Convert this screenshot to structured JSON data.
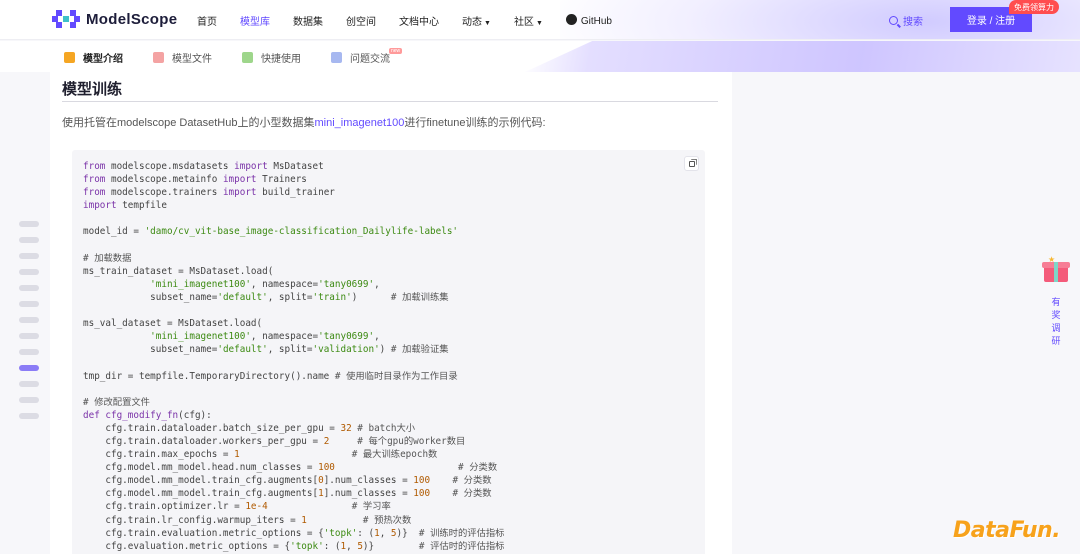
{
  "brand": {
    "name": "ModelScope",
    "accent": "#624aff"
  },
  "nav": {
    "items": [
      {
        "label": "首页",
        "active": false
      },
      {
        "label": "模型库",
        "active": true
      },
      {
        "label": "数据集",
        "active": false
      },
      {
        "label": "创空间",
        "active": false
      },
      {
        "label": "文档中心",
        "active": false
      },
      {
        "label": "动态",
        "active": false,
        "dropdown": true
      },
      {
        "label": "社区",
        "active": false,
        "dropdown": true
      },
      {
        "label": "GitHub",
        "active": false,
        "icon": "github-icon"
      }
    ],
    "search_label": "搜索",
    "login_label": "登录 / 注册",
    "badge": "免费领算力"
  },
  "subtabs": [
    {
      "label": "模型介绍",
      "active": true,
      "icon": "cube-icon",
      "color": "#f5a623"
    },
    {
      "label": "模型文件",
      "active": false,
      "icon": "file-icon",
      "color": "#f4a3a3"
    },
    {
      "label": "快捷使用",
      "active": false,
      "icon": "send-icon",
      "color": "#9ed68b"
    },
    {
      "label": "问题交流",
      "active": false,
      "icon": "chat-icon",
      "color": "#a7b8f0",
      "badge": "new"
    }
  ],
  "section": {
    "title": "模型训练",
    "intro_before": "使用托管在modelscope DatasetHub上的小型数据集",
    "intro_link": "mini_imagenet100",
    "intro_after": "进行finetune训练的示例代码:"
  },
  "code_lines": [
    [
      [
        "kw",
        "from"
      ],
      [
        "t",
        " modelscope.msdatasets "
      ],
      [
        "kw",
        "import"
      ],
      [
        "t",
        " MsDataset"
      ]
    ],
    [
      [
        "kw",
        "from"
      ],
      [
        "t",
        " modelscope.metainfo "
      ],
      [
        "kw",
        "import"
      ],
      [
        "t",
        " Trainers"
      ]
    ],
    [
      [
        "kw",
        "from"
      ],
      [
        "t",
        " modelscope.trainers "
      ],
      [
        "kw",
        "import"
      ],
      [
        "t",
        " build_trainer"
      ]
    ],
    [
      [
        "kw",
        "import"
      ],
      [
        "t",
        " tempfile"
      ]
    ],
    [],
    [
      [
        "t",
        "model_id = "
      ],
      [
        "str",
        "'damo/cv_vit-base_image-classification_Dailylife-labels'"
      ]
    ],
    [],
    [
      [
        "cm",
        "# 加载数据"
      ]
    ],
    [
      [
        "t",
        "ms_train_dataset = MsDataset.load("
      ]
    ],
    [
      [
        "t",
        "            "
      ],
      [
        "str",
        "'mini_imagenet100'"
      ],
      [
        "t",
        ", namespace="
      ],
      [
        "str",
        "'tany0699'"
      ],
      [
        "t",
        ","
      ]
    ],
    [
      [
        "t",
        "            subset_name="
      ],
      [
        "str",
        "'default'"
      ],
      [
        "t",
        ", split="
      ],
      [
        "str",
        "'train'"
      ],
      [
        "t",
        ")      "
      ],
      [
        "cm",
        "# 加载训练集"
      ]
    ],
    [],
    [
      [
        "t",
        "ms_val_dataset = MsDataset.load("
      ]
    ],
    [
      [
        "t",
        "            "
      ],
      [
        "str",
        "'mini_imagenet100'"
      ],
      [
        "t",
        ", namespace="
      ],
      [
        "str",
        "'tany0699'"
      ],
      [
        "t",
        ","
      ]
    ],
    [
      [
        "t",
        "            subset_name="
      ],
      [
        "str",
        "'default'"
      ],
      [
        "t",
        ", split="
      ],
      [
        "str",
        "'validation'"
      ],
      [
        "t",
        ") "
      ],
      [
        "cm",
        "# 加载验证集"
      ]
    ],
    [],
    [
      [
        "t",
        "tmp_dir = tempfile.TemporaryDirectory().name "
      ],
      [
        "cm",
        "# 使用临时目录作为工作目录"
      ]
    ],
    [],
    [
      [
        "cm",
        "# 修改配置文件"
      ]
    ],
    [
      [
        "kw",
        "def"
      ],
      [
        "kw",
        " cfg_modify_fn"
      ],
      [
        "t",
        "(cfg):"
      ]
    ],
    [
      [
        "t",
        "    cfg.train.dataloader.batch_size_per_gpu = "
      ],
      [
        "num",
        "32"
      ],
      [
        "t",
        " "
      ],
      [
        "cm",
        "# batch大小"
      ]
    ],
    [
      [
        "t",
        "    cfg.train.dataloader.workers_per_gpu = "
      ],
      [
        "num",
        "2"
      ],
      [
        "t",
        "     "
      ],
      [
        "cm",
        "# 每个gpu的worker数目"
      ]
    ],
    [
      [
        "t",
        "    cfg.train.max_epochs = "
      ],
      [
        "num",
        "1"
      ],
      [
        "t",
        "                    "
      ],
      [
        "cm",
        "# 最大训练epoch数"
      ]
    ],
    [
      [
        "t",
        "    cfg.model.mm_model.head.num_classes = "
      ],
      [
        "num",
        "100"
      ],
      [
        "t",
        "                      "
      ],
      [
        "cm",
        "# 分类数"
      ]
    ],
    [
      [
        "t",
        "    cfg.model.mm_model.train_cfg.augments["
      ],
      [
        "num",
        "0"
      ],
      [
        "t",
        "].num_classes = "
      ],
      [
        "num",
        "100"
      ],
      [
        "t",
        "    "
      ],
      [
        "cm",
        "# 分类数"
      ]
    ],
    [
      [
        "t",
        "    cfg.model.mm_model.train_cfg.augments["
      ],
      [
        "num",
        "1"
      ],
      [
        "t",
        "].num_classes = "
      ],
      [
        "num",
        "100"
      ],
      [
        "t",
        "    "
      ],
      [
        "cm",
        "# 分类数"
      ]
    ],
    [
      [
        "t",
        "    cfg.train.optimizer.lr = "
      ],
      [
        "num",
        "1e-4"
      ],
      [
        "t",
        "               "
      ],
      [
        "cm",
        "# 学习率"
      ]
    ],
    [
      [
        "t",
        "    cfg.train.lr_config.warmup_iters = "
      ],
      [
        "num",
        "1"
      ],
      [
        "t",
        "          "
      ],
      [
        "cm",
        "# 预热次数"
      ]
    ],
    [
      [
        "t",
        "    cfg.train.evaluation.metric_options = {"
      ],
      [
        "str",
        "'topk'"
      ],
      [
        "t",
        ": ("
      ],
      [
        "num",
        "1"
      ],
      [
        "t",
        ", "
      ],
      [
        "num",
        "5"
      ],
      [
        "t",
        ")}  "
      ],
      [
        "cm",
        "# 训练时的评估指标"
      ]
    ],
    [
      [
        "t",
        "    cfg.evaluation.metric_options = {"
      ],
      [
        "str",
        "'topk'"
      ],
      [
        "t",
        ": ("
      ],
      [
        "num",
        "1"
      ],
      [
        "t",
        ", "
      ],
      [
        "num",
        "5"
      ],
      [
        "t",
        ")}        "
      ],
      [
        "cm",
        "# 评估时的评估指标"
      ]
    ]
  ],
  "outline_active_index": 9,
  "survey": {
    "label": "有奖调研"
  },
  "watermark": {
    "text": "DataFun."
  }
}
